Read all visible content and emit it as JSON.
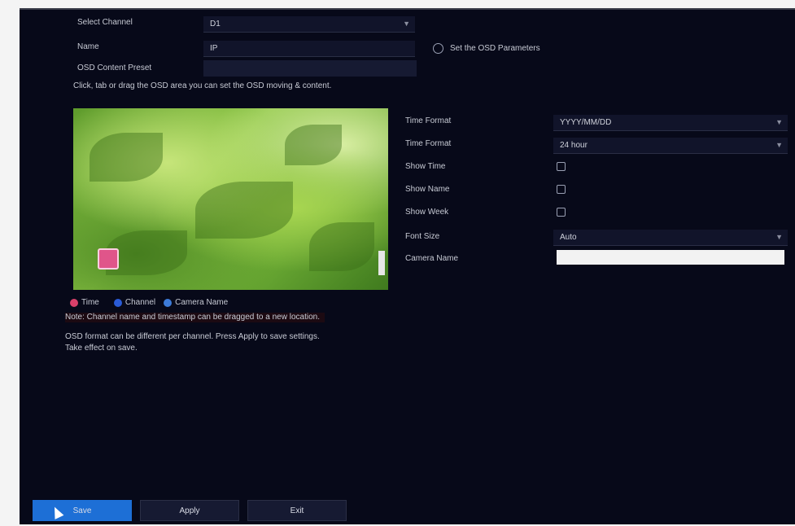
{
  "top": {
    "channel_label": "Select Channel",
    "channel_value": "D1",
    "name_label": "Name",
    "name_value": "IP",
    "osd_label": "OSD Content Preset",
    "link_label": "Set the OSD Parameters",
    "hint": "Click, tab or drag the OSD area you can set the OSD moving & content."
  },
  "settings": {
    "items": [
      {
        "label": "Time Format",
        "value": "YYYY/MM/DD"
      },
      {
        "label": "Time Format",
        "value": "24 hour"
      },
      {
        "label": "Show Time",
        "checked": true
      },
      {
        "label": "Show Name",
        "checked": true
      },
      {
        "label": "Show Week",
        "checked": true
      },
      {
        "label": "Font Size",
        "value": "Auto"
      },
      {
        "label": "Camera Name",
        "value": ""
      }
    ]
  },
  "legend": {
    "items": [
      {
        "label": "Time",
        "color": "#d9406a"
      },
      {
        "label": "Channel",
        "color": "#2a5bd7"
      },
      {
        "label": "Camera Name",
        "color": "#3d7bd9"
      }
    ]
  },
  "notes": {
    "line1": "Note: Channel name and timestamp can be dragged to a new location.",
    "line2": "OSD format can be different per channel. Press Apply to save settings.",
    "line3": "Take effect on save."
  },
  "buttons": {
    "save": "Save",
    "apply": "Apply",
    "exit": "Exit"
  },
  "icons": {
    "dropdown": "chevron-down-icon",
    "link": "plus-circle-icon",
    "cursor": "mouse-pointer-icon"
  }
}
